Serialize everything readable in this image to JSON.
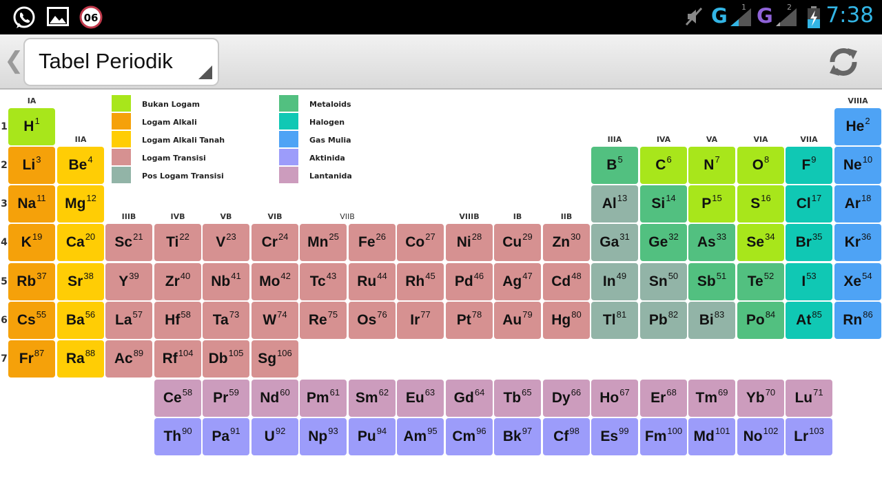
{
  "status_bar": {
    "left_icons": [
      "whatsapp-icon",
      "gallery-icon",
      "calendar-badge-icon"
    ],
    "badge_text": "06",
    "right_icons": [
      "mute-icon",
      "signal-icon",
      "battery-charging-icon"
    ],
    "network_1": "G",
    "network_1_sim": "1",
    "network_2": "G",
    "network_2_sim": "2",
    "time": "7:38"
  },
  "action_bar": {
    "title": "Tabel Periodik",
    "back_icon": "chevron-left-icon",
    "refresh_icon": "refresh-icon"
  },
  "group_labels": [
    "IA",
    "IIA",
    "IIIB",
    "IVB",
    "VB",
    "VIB",
    "VIIB",
    "VIIIB",
    "IB",
    "IIB",
    "IIIA",
    "IVA",
    "VA",
    "VIA",
    "VIIA",
    "VIIIA"
  ],
  "period_labels": [
    "1",
    "2",
    "3",
    "4",
    "5",
    "6",
    "7"
  ],
  "colors": {
    "nonmetal": "#a8e61b",
    "alkali": "#f5a10a",
    "alkaline_earth": "#ffcd05",
    "transition": "#d69191",
    "post_transition": "#92b4a7",
    "metalloid": "#52c080",
    "halogen": "#10c8b4",
    "noble_gas": "#4ea3f5",
    "actinide": "#9c9cfa",
    "lanthanide": "#cc9cbd"
  },
  "legend": [
    {
      "label": "Bukan Logam",
      "category": "nonmetal"
    },
    {
      "label": "Logam Alkali",
      "category": "alkali"
    },
    {
      "label": "Logam Alkali Tanah",
      "category": "alkaline_earth"
    },
    {
      "label": "Logam Transisi",
      "category": "transition"
    },
    {
      "label": "Pos Logam Transisi",
      "category": "post_transition"
    },
    {
      "label": "Metaloids",
      "category": "metalloid"
    },
    {
      "label": "Halogen",
      "category": "halogen"
    },
    {
      "label": "Gas Mulia",
      "category": "noble_gas"
    },
    {
      "label": "Aktinida",
      "category": "actinide"
    },
    {
      "label": "Lantanida",
      "category": "lanthanide"
    }
  ],
  "elements": [
    {
      "symbol": "H",
      "number": "1",
      "category": "nonmetal",
      "row": 1,
      "col": 1
    },
    {
      "symbol": "He",
      "number": "2",
      "category": "noble_gas",
      "row": 1,
      "col": 18
    },
    {
      "symbol": "Li",
      "number": "3",
      "category": "alkali",
      "row": 2,
      "col": 1
    },
    {
      "symbol": "Be",
      "number": "4",
      "category": "alkaline_earth",
      "row": 2,
      "col": 2
    },
    {
      "symbol": "B",
      "number": "5",
      "category": "metalloid",
      "row": 2,
      "col": 13
    },
    {
      "symbol": "C",
      "number": "6",
      "category": "nonmetal",
      "row": 2,
      "col": 14
    },
    {
      "symbol": "N",
      "number": "7",
      "category": "nonmetal",
      "row": 2,
      "col": 15
    },
    {
      "symbol": "O",
      "number": "8",
      "category": "nonmetal",
      "row": 2,
      "col": 16
    },
    {
      "symbol": "F",
      "number": "9",
      "category": "halogen",
      "row": 2,
      "col": 17
    },
    {
      "symbol": "Ne",
      "number": "10",
      "category": "noble_gas",
      "row": 2,
      "col": 18
    },
    {
      "symbol": "Na",
      "number": "11",
      "category": "alkali",
      "row": 3,
      "col": 1
    },
    {
      "symbol": "Mg",
      "number": "12",
      "category": "alkaline_earth",
      "row": 3,
      "col": 2
    },
    {
      "symbol": "Al",
      "number": "13",
      "category": "post_transition",
      "row": 3,
      "col": 13
    },
    {
      "symbol": "Si",
      "number": "14",
      "category": "metalloid",
      "row": 3,
      "col": 14
    },
    {
      "symbol": "P",
      "number": "15",
      "category": "nonmetal",
      "row": 3,
      "col": 15
    },
    {
      "symbol": "S",
      "number": "16",
      "category": "nonmetal",
      "row": 3,
      "col": 16
    },
    {
      "symbol": "Cl",
      "number": "17",
      "category": "halogen",
      "row": 3,
      "col": 17
    },
    {
      "symbol": "Ar",
      "number": "18",
      "category": "noble_gas",
      "row": 3,
      "col": 18
    },
    {
      "symbol": "K",
      "number": "19",
      "category": "alkali",
      "row": 4,
      "col": 1
    },
    {
      "symbol": "Ca",
      "number": "20",
      "category": "alkaline_earth",
      "row": 4,
      "col": 2
    },
    {
      "symbol": "Sc",
      "number": "21",
      "category": "transition",
      "row": 4,
      "col": 3
    },
    {
      "symbol": "Ti",
      "number": "22",
      "category": "transition",
      "row": 4,
      "col": 4
    },
    {
      "symbol": "V",
      "number": "23",
      "category": "transition",
      "row": 4,
      "col": 5
    },
    {
      "symbol": "Cr",
      "number": "24",
      "category": "transition",
      "row": 4,
      "col": 6
    },
    {
      "symbol": "Mn",
      "number": "25",
      "category": "transition",
      "row": 4,
      "col": 7
    },
    {
      "symbol": "Fe",
      "number": "26",
      "category": "transition",
      "row": 4,
      "col": 8
    },
    {
      "symbol": "Co",
      "number": "27",
      "category": "transition",
      "row": 4,
      "col": 9
    },
    {
      "symbol": "Ni",
      "number": "28",
      "category": "transition",
      "row": 4,
      "col": 10
    },
    {
      "symbol": "Cu",
      "number": "29",
      "category": "transition",
      "row": 4,
      "col": 11
    },
    {
      "symbol": "Zn",
      "number": "30",
      "category": "transition",
      "row": 4,
      "col": 12
    },
    {
      "symbol": "Ga",
      "number": "31",
      "category": "post_transition",
      "row": 4,
      "col": 13
    },
    {
      "symbol": "Ge",
      "number": "32",
      "category": "metalloid",
      "row": 4,
      "col": 14
    },
    {
      "symbol": "As",
      "number": "33",
      "category": "metalloid",
      "row": 4,
      "col": 15
    },
    {
      "symbol": "Se",
      "number": "34",
      "category": "nonmetal",
      "row": 4,
      "col": 16
    },
    {
      "symbol": "Br",
      "number": "35",
      "category": "halogen",
      "row": 4,
      "col": 17
    },
    {
      "symbol": "Kr",
      "number": "36",
      "category": "noble_gas",
      "row": 4,
      "col": 18
    },
    {
      "symbol": "Rb",
      "number": "37",
      "category": "alkali",
      "row": 5,
      "col": 1
    },
    {
      "symbol": "Sr",
      "number": "38",
      "category": "alkaline_earth",
      "row": 5,
      "col": 2
    },
    {
      "symbol": "Y",
      "number": "39",
      "category": "transition",
      "row": 5,
      "col": 3
    },
    {
      "symbol": "Zr",
      "number": "40",
      "category": "transition",
      "row": 5,
      "col": 4
    },
    {
      "symbol": "Nb",
      "number": "41",
      "category": "transition",
      "row": 5,
      "col": 5
    },
    {
      "symbol": "Mo",
      "number": "42",
      "category": "transition",
      "row": 5,
      "col": 6
    },
    {
      "symbol": "Tc",
      "number": "43",
      "category": "transition",
      "row": 5,
      "col": 7
    },
    {
      "symbol": "Ru",
      "number": "44",
      "category": "transition",
      "row": 5,
      "col": 8
    },
    {
      "symbol": "Rh",
      "number": "45",
      "category": "transition",
      "row": 5,
      "col": 9
    },
    {
      "symbol": "Pd",
      "number": "46",
      "category": "transition",
      "row": 5,
      "col": 10
    },
    {
      "symbol": "Ag",
      "number": "47",
      "category": "transition",
      "row": 5,
      "col": 11
    },
    {
      "symbol": "Cd",
      "number": "48",
      "category": "transition",
      "row": 5,
      "col": 12
    },
    {
      "symbol": "In",
      "number": "49",
      "category": "post_transition",
      "row": 5,
      "col": 13
    },
    {
      "symbol": "Sn",
      "number": "50",
      "category": "post_transition",
      "row": 5,
      "col": 14
    },
    {
      "symbol": "Sb",
      "number": "51",
      "category": "metalloid",
      "row": 5,
      "col": 15
    },
    {
      "symbol": "Te",
      "number": "52",
      "category": "metalloid",
      "row": 5,
      "col": 16
    },
    {
      "symbol": "I",
      "number": "53",
      "category": "halogen",
      "row": 5,
      "col": 17
    },
    {
      "symbol": "Xe",
      "number": "54",
      "category": "noble_gas",
      "row": 5,
      "col": 18
    },
    {
      "symbol": "Cs",
      "number": "55",
      "category": "alkali",
      "row": 6,
      "col": 1
    },
    {
      "symbol": "Ba",
      "number": "56",
      "category": "alkaline_earth",
      "row": 6,
      "col": 2
    },
    {
      "symbol": "La",
      "number": "57",
      "category": "transition",
      "row": 6,
      "col": 3
    },
    {
      "symbol": "Hf",
      "number": "58",
      "category": "transition",
      "row": 6,
      "col": 4
    },
    {
      "symbol": "Ta",
      "number": "73",
      "category": "transition",
      "row": 6,
      "col": 5
    },
    {
      "symbol": "W",
      "number": "74",
      "category": "transition",
      "row": 6,
      "col": 6
    },
    {
      "symbol": "Re",
      "number": "75",
      "category": "transition",
      "row": 6,
      "col": 7
    },
    {
      "symbol": "Os",
      "number": "76",
      "category": "transition",
      "row": 6,
      "col": 8
    },
    {
      "symbol": "Ir",
      "number": "77",
      "category": "transition",
      "row": 6,
      "col": 9
    },
    {
      "symbol": "Pt",
      "number": "78",
      "category": "transition",
      "row": 6,
      "col": 10
    },
    {
      "symbol": "Au",
      "number": "79",
      "category": "transition",
      "row": 6,
      "col": 11
    },
    {
      "symbol": "Hg",
      "number": "80",
      "category": "transition",
      "row": 6,
      "col": 12
    },
    {
      "symbol": "Tl",
      "number": "81",
      "category": "post_transition",
      "row": 6,
      "col": 13
    },
    {
      "symbol": "Pb",
      "number": "82",
      "category": "post_transition",
      "row": 6,
      "col": 14
    },
    {
      "symbol": "Bi",
      "number": "83",
      "category": "post_transition",
      "row": 6,
      "col": 15
    },
    {
      "symbol": "Po",
      "number": "84",
      "category": "metalloid",
      "row": 6,
      "col": 16
    },
    {
      "symbol": "At",
      "number": "85",
      "category": "halogen",
      "row": 6,
      "col": 17
    },
    {
      "symbol": "Rn",
      "number": "86",
      "category": "noble_gas",
      "row": 6,
      "col": 18
    },
    {
      "symbol": "Fr",
      "number": "87",
      "category": "alkali",
      "row": 7,
      "col": 1
    },
    {
      "symbol": "Ra",
      "number": "88",
      "category": "alkaline_earth",
      "row": 7,
      "col": 2
    },
    {
      "symbol": "Ac",
      "number": "89",
      "category": "transition",
      "row": 7,
      "col": 3
    },
    {
      "symbol": "Rf",
      "number": "104",
      "category": "transition",
      "row": 7,
      "col": 4
    },
    {
      "symbol": "Db",
      "number": "105",
      "category": "transition",
      "row": 7,
      "col": 5
    },
    {
      "symbol": "Sg",
      "number": "106",
      "category": "transition",
      "row": 7,
      "col": 6
    },
    {
      "symbol": "Ce",
      "number": "58",
      "category": "lanthanide",
      "row": 8,
      "col": 4
    },
    {
      "symbol": "Pr",
      "number": "59",
      "category": "lanthanide",
      "row": 8,
      "col": 5
    },
    {
      "symbol": "Nd",
      "number": "60",
      "category": "lanthanide",
      "row": 8,
      "col": 6
    },
    {
      "symbol": "Pm",
      "number": "61",
      "category": "lanthanide",
      "row": 8,
      "col": 7
    },
    {
      "symbol": "Sm",
      "number": "62",
      "category": "lanthanide",
      "row": 8,
      "col": 8
    },
    {
      "symbol": "Eu",
      "number": "63",
      "category": "lanthanide",
      "row": 8,
      "col": 9
    },
    {
      "symbol": "Gd",
      "number": "64",
      "category": "lanthanide",
      "row": 8,
      "col": 10
    },
    {
      "symbol": "Tb",
      "number": "65",
      "category": "lanthanide",
      "row": 8,
      "col": 11
    },
    {
      "symbol": "Dy",
      "number": "66",
      "category": "lanthanide",
      "row": 8,
      "col": 12
    },
    {
      "symbol": "Ho",
      "number": "67",
      "category": "lanthanide",
      "row": 8,
      "col": 13
    },
    {
      "symbol": "Er",
      "number": "68",
      "category": "lanthanide",
      "row": 8,
      "col": 14
    },
    {
      "symbol": "Tm",
      "number": "69",
      "category": "lanthanide",
      "row": 8,
      "col": 15
    },
    {
      "symbol": "Yb",
      "number": "70",
      "category": "lanthanide",
      "row": 8,
      "col": 16
    },
    {
      "symbol": "Lu",
      "number": "71",
      "category": "lanthanide",
      "row": 8,
      "col": 17
    },
    {
      "symbol": "Th",
      "number": "90",
      "category": "actinide",
      "row": 9,
      "col": 4
    },
    {
      "symbol": "Pa",
      "number": "91",
      "category": "actinide",
      "row": 9,
      "col": 5
    },
    {
      "symbol": "U",
      "number": "92",
      "category": "actinide",
      "row": 9,
      "col": 6
    },
    {
      "symbol": "Np",
      "number": "93",
      "category": "actinide",
      "row": 9,
      "col": 7
    },
    {
      "symbol": "Pu",
      "number": "94",
      "category": "actinide",
      "row": 9,
      "col": 8
    },
    {
      "symbol": "Am",
      "number": "95",
      "category": "actinide",
      "row": 9,
      "col": 9
    },
    {
      "symbol": "Cm",
      "number": "96",
      "category": "actinide",
      "row": 9,
      "col": 10
    },
    {
      "symbol": "Bk",
      "number": "97",
      "category": "actinide",
      "row": 9,
      "col": 11
    },
    {
      "symbol": "Cf",
      "number": "98",
      "category": "actinide",
      "row": 9,
      "col": 12
    },
    {
      "symbol": "Es",
      "number": "99",
      "category": "actinide",
      "row": 9,
      "col": 13
    },
    {
      "symbol": "Fm",
      "number": "100",
      "category": "actinide",
      "row": 9,
      "col": 14
    },
    {
      "symbol": "Md",
      "number": "101",
      "category": "actinide",
      "row": 9,
      "col": 15
    },
    {
      "symbol": "No",
      "number": "102",
      "category": "actinide",
      "row": 9,
      "col": 16
    },
    {
      "symbol": "Lr",
      "number": "103",
      "category": "actinide",
      "row": 9,
      "col": 17
    }
  ]
}
